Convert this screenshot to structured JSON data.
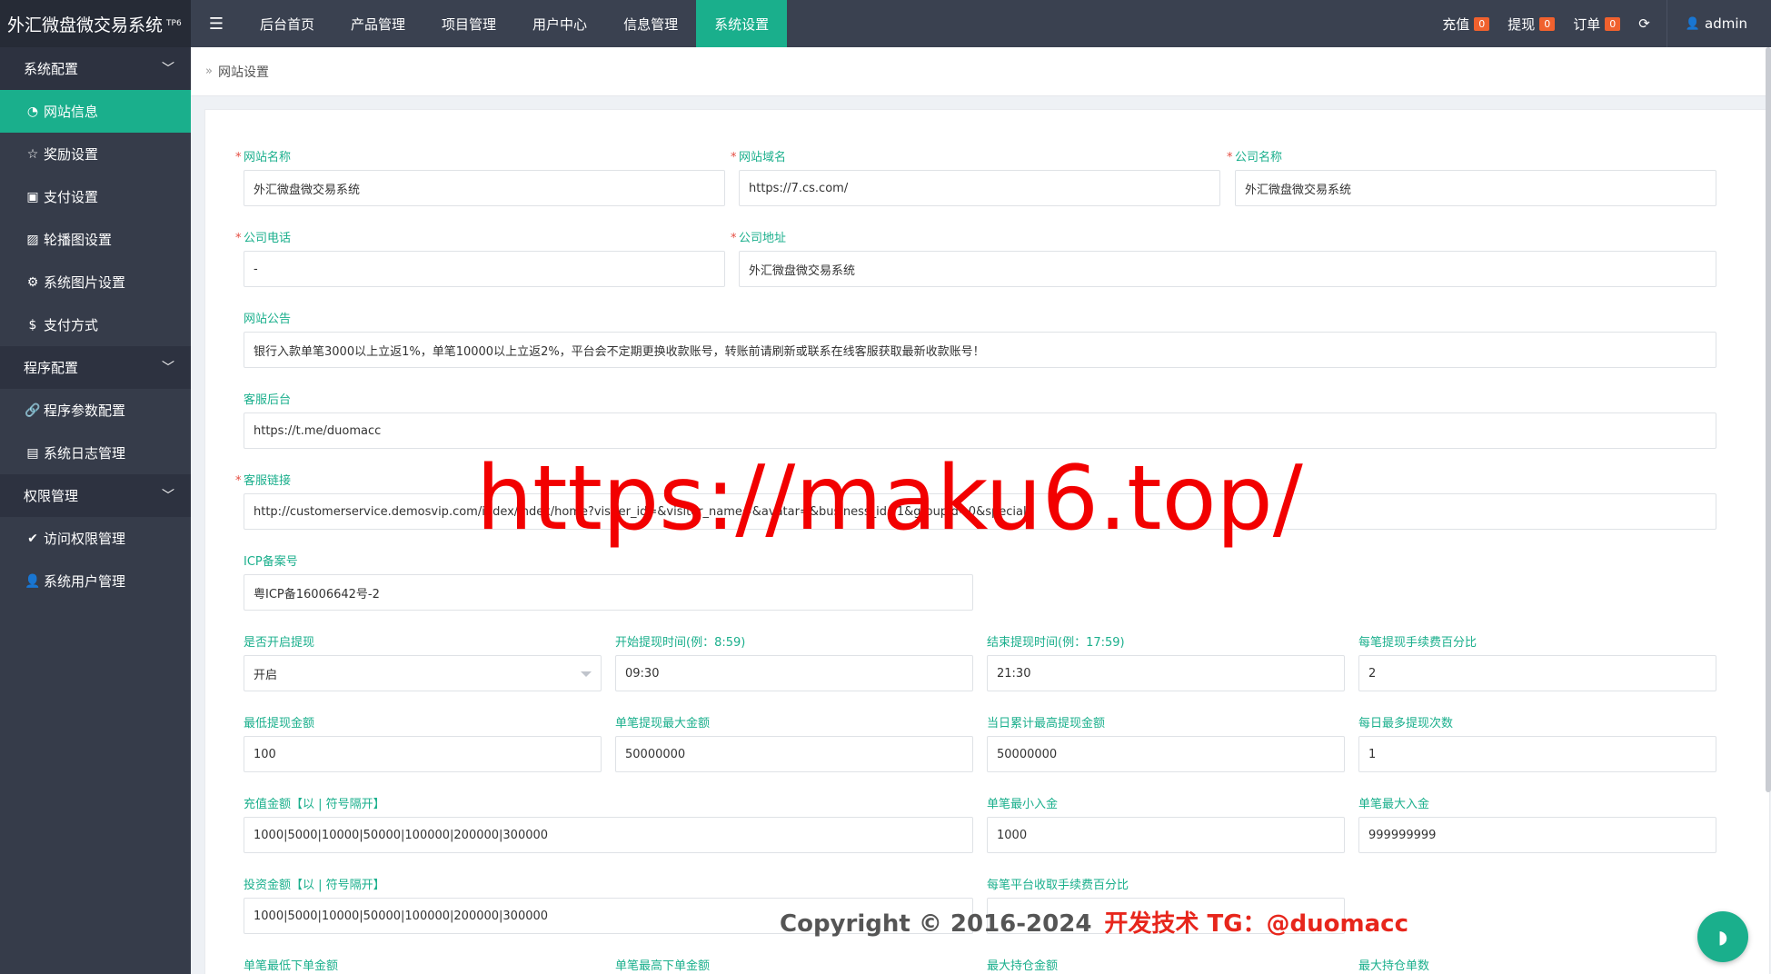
{
  "app": {
    "title": "外汇微盘微交易系统",
    "version_tag": "TP6"
  },
  "header": {
    "menu_icon": "hamburger-icon",
    "nav": [
      {
        "label": "后台首页",
        "active": false
      },
      {
        "label": "产品管理",
        "active": false
      },
      {
        "label": "项目管理",
        "active": false
      },
      {
        "label": "用户中心",
        "active": false
      },
      {
        "label": "信息管理",
        "active": false
      },
      {
        "label": "系统设置",
        "active": true
      }
    ],
    "recharge": {
      "label": "充值",
      "count": "0"
    },
    "withdraw": {
      "label": "提现",
      "count": "0"
    },
    "orders": {
      "label": "订单",
      "count": "0"
    },
    "refresh_icon": "refresh-icon",
    "user": "admin"
  },
  "sidebar": {
    "groups": [
      {
        "label": "系统配置",
        "items": [
          {
            "label": "网站信息",
            "icon": "dashboard-icon",
            "active": true
          },
          {
            "label": "奖励设置",
            "icon": "star-icon",
            "active": false
          },
          {
            "label": "支付设置",
            "icon": "card-icon",
            "active": false
          },
          {
            "label": "轮播图设置",
            "icon": "image-icon",
            "active": false
          },
          {
            "label": "系统图片设置",
            "icon": "gear-icon",
            "active": false
          },
          {
            "label": "支付方式",
            "icon": "dollar-icon",
            "active": false
          }
        ]
      },
      {
        "label": "程序配置",
        "items": [
          {
            "label": "程序参数配置",
            "icon": "link-icon",
            "active": false
          },
          {
            "label": "系统日志管理",
            "icon": "clipboard-icon",
            "active": false
          }
        ]
      },
      {
        "label": "权限管理",
        "items": [
          {
            "label": "访问权限管理",
            "icon": "check-shield-icon",
            "active": false
          },
          {
            "label": "系统用户管理",
            "icon": "user-icon",
            "active": false
          }
        ]
      }
    ]
  },
  "breadcrumb": {
    "current": "网站设置"
  },
  "form": {
    "site_name": {
      "label": "网站名称",
      "value": "外汇微盘微交易系统",
      "required": true
    },
    "site_domain": {
      "label": "网站域名",
      "value": "https://7.cs.com/",
      "required": true
    },
    "company_name": {
      "label": "公司名称",
      "value": "外汇微盘微交易系统",
      "required": true
    },
    "company_phone": {
      "label": "公司电话",
      "value": "-",
      "required": true
    },
    "company_address": {
      "label": "公司地址",
      "value": "外汇微盘微交易系统",
      "required": true
    },
    "notice": {
      "label": "网站公告",
      "value": "银行入款单笔3000以上立返1%，单笔10000以上立返2%，平台会不定期更换收款账号，转账前请刷新或联系在线客服获取最新收款账号！"
    },
    "cs_backend": {
      "label": "客服后台",
      "value": "https://t.me/duomacc"
    },
    "cs_link": {
      "label": "客服链接",
      "value": "http://customerservice.demosvip.com/index/index/home?visiter_id=&visiter_name=&avatar=&business_id=1&groupid=0&special",
      "required": true
    },
    "icp": {
      "label": "ICP备案号",
      "value": "粤ICP备16006642号-2"
    },
    "withdraw_enabled": {
      "label": "是否开启提现",
      "value": "开启"
    },
    "withdraw_start": {
      "label": "开始提现时间(例：8:59)",
      "value": "09:30"
    },
    "withdraw_end": {
      "label": "结束提现时间(例：17:59)",
      "value": "21:30"
    },
    "withdraw_fee": {
      "label": "每笔提现手续费百分比",
      "value": "2"
    },
    "min_withdraw": {
      "label": "最低提现金额",
      "value": "100"
    },
    "max_withdraw_single": {
      "label": "单笔提现最大金额",
      "value": "50000000"
    },
    "max_withdraw_daily": {
      "label": "当日累计最高提现金额",
      "value": "50000000"
    },
    "max_withdraw_times": {
      "label": "每日最多提现次数",
      "value": "1"
    },
    "recharge_amounts": {
      "label": "充值金额【以 | 符号隔开】",
      "value": "1000|5000|10000|50000|100000|200000|300000"
    },
    "min_deposit": {
      "label": "单笔最小入金",
      "value": "1000"
    },
    "max_deposit": {
      "label": "单笔最大入金",
      "value": "999999999"
    },
    "invest_amounts": {
      "label": "投资金额【以 | 符号隔开】",
      "value": "1000|5000|10000|50000|100000|200000|300000"
    },
    "platform_fee": {
      "label": "每笔平台收取手续费百分比",
      "value": ""
    },
    "min_order": {
      "label": "单笔最低下单金额"
    },
    "max_order": {
      "label": "单笔最高下单金额"
    },
    "max_position_amount": {
      "label": "最大持仓金额"
    },
    "max_position_count": {
      "label": "最大持仓单数"
    }
  },
  "watermark": {
    "url": "https://maku6.top/",
    "copyright": "Copyright © 2016-2024",
    "contact": "开发技术 TG：@duomacc"
  },
  "colors": {
    "accent": "#1aaf8c",
    "topbar": "#3a4150",
    "sidebar": "#363c4a",
    "badge": "#f0612e"
  }
}
